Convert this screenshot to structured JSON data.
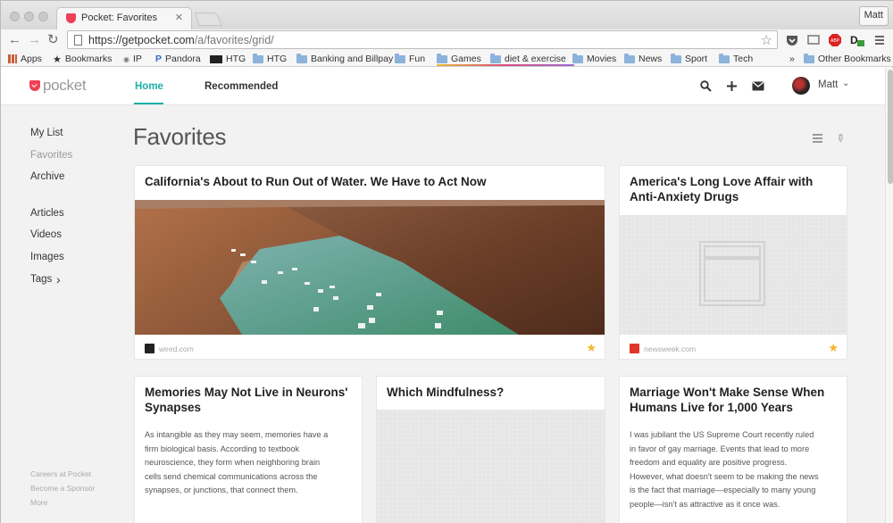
{
  "browser": {
    "tab_title": "Pocket: Favorites",
    "profile": "Matt",
    "url_host": "https://getpocket.com",
    "url_path": "/a/favorites/grid/",
    "bookmarks": [
      "Apps",
      "Bookmarks",
      "IP",
      "Pandora",
      "HTG",
      "HTG",
      "Banking and Billpay",
      "Fun",
      "Games",
      "diet & exercise",
      "Movies",
      "News",
      "Sport",
      "Tech"
    ],
    "overflow": "»",
    "other_bookmarks": "Other Bookmarks"
  },
  "header": {
    "logo": "pocket",
    "nav": [
      "Home",
      "Recommended"
    ],
    "user": "Matt"
  },
  "sidebar": {
    "primary": [
      "My List",
      "Favorites",
      "Archive"
    ],
    "secondary": [
      "Articles",
      "Videos",
      "Images",
      "Tags"
    ],
    "tags_arrow": "›",
    "footer": [
      "Careers at Pocket",
      "Become a Sponsor",
      "More"
    ]
  },
  "page": {
    "title": "Favorites"
  },
  "cards": [
    {
      "title": "California's About to Run Out of Water. We Have to Act Now",
      "source": "wired.com",
      "favorite": true
    },
    {
      "title": "America's Long Love Affair with Anti-Anxiety Drugs",
      "source": "newsweek.com",
      "favorite": true
    },
    {
      "title": "Memories May Not Live in Neurons' Synapses",
      "excerpt": [
        "As intangible as they may seem, memories have a",
        "firm biological basis. According to textbook",
        "neuroscience, they form when neighboring brain",
        "cells send chemical communications across the",
        "synapses, or junctions, that connect them."
      ]
    },
    {
      "title": "Which Mindfulness?"
    },
    {
      "title": "Marriage Won't Make Sense When Humans Live for 1,000 Years",
      "excerpt": [
        "I was jubilant the US Supreme Court recently ruled",
        "in favor of gay marriage. Events that lead to more",
        "freedom and equality are positive progress.",
        "However, what doesn't seem to be making the news",
        "is the fact that marriage—especially to many young",
        "people—isn't as attractive as it once was."
      ]
    }
  ],
  "colors": {
    "accent": "#1cb0a8",
    "brand": "#ee4056",
    "star": "#f3b62c"
  },
  "icons": [
    "back-icon",
    "forward-icon",
    "reload-icon",
    "bookmark-star-icon",
    "search-icon",
    "add-icon",
    "inbox-icon",
    "list-view-icon",
    "tag-icon",
    "favorite-star-icon"
  ]
}
